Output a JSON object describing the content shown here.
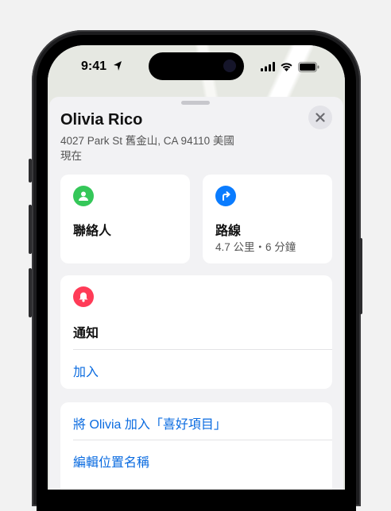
{
  "colors": {
    "accent": "#0a6be0",
    "contact_icon_bg": "#35c759",
    "directions_icon_bg": "#0a7cff",
    "notification_icon_bg": "#ff3b57"
  },
  "status_bar": {
    "time": "9:41",
    "icons": [
      "location-arrow-icon",
      "cellular-signal-icon",
      "wifi-icon",
      "battery-icon"
    ]
  },
  "person": {
    "name": "Olivia Rico",
    "address": "4027 Park St 舊金山, CA  94110 美國",
    "time": "現在"
  },
  "contact": {
    "label": "聯絡人",
    "icon": "person-icon"
  },
  "directions": {
    "label": "路線",
    "detail": "4.7 公里・6 分鐘",
    "icon": "turn-right-arrow-icon"
  },
  "notifications": {
    "label": "通知",
    "icon": "bell-icon",
    "add_label": "加入"
  },
  "actions": {
    "add_favorite": "將 Olivia 加入「喜好項目」",
    "edit_location_name": "編輯位置名稱"
  }
}
